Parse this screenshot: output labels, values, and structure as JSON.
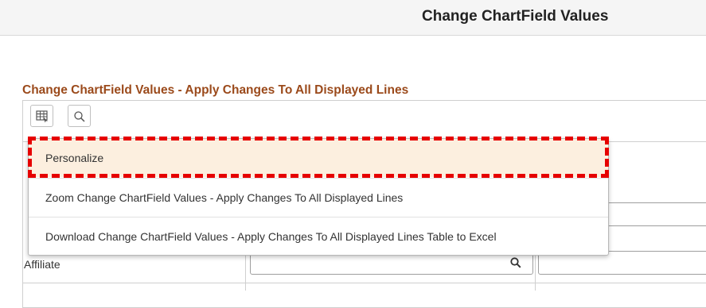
{
  "page": {
    "title": "Change ChartField Values"
  },
  "section": {
    "title": "Change ChartField Values - Apply Changes To All Displayed Lines"
  },
  "toolbar": {
    "buttons": [
      {
        "icon": "grid-settings-icon"
      },
      {
        "icon": "search-icon"
      }
    ]
  },
  "menu": {
    "items": [
      {
        "label": "Personalize",
        "highlighted": true
      },
      {
        "label": "Zoom Change ChartField Values - Apply Changes To All Displayed Lines"
      },
      {
        "label": "Download Change ChartField Values - Apply Changes To All Displayed Lines Table to Excel"
      }
    ]
  },
  "grid": {
    "row_label": "Affiliate"
  },
  "colors": {
    "section_title": "#9b4a1b",
    "highlight_dash": "#e60000",
    "hover_bg": "#fcefdf"
  }
}
